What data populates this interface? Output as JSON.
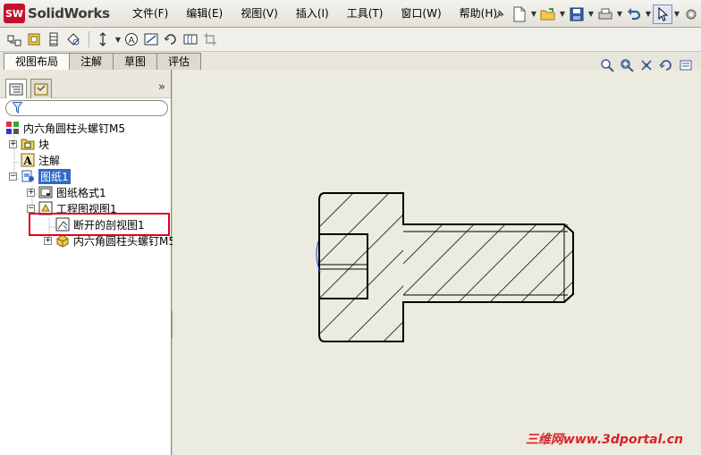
{
  "app": {
    "logo_text": "SolidWorks",
    "logo_badge": "SW"
  },
  "menu": {
    "items": [
      "文件(F)",
      "编辑(E)",
      "视图(V)",
      "插入(I)",
      "工具(T)",
      "窗口(W)",
      "帮助(H)"
    ]
  },
  "title_toolbar": {
    "icons": [
      "pushpin-icon",
      "new-document-icon",
      "open-folder-icon",
      "save-icon",
      "print-icon",
      "undo-icon",
      "select-arrow-icon",
      "options-icon"
    ]
  },
  "toolbar2": {
    "icons": [
      "model-view-icon",
      "projected-view-icon",
      "section-view-icon",
      "detail-view-icon",
      "alignment-icon",
      "text-annotation-icon",
      "block-icon",
      "rotate-icon",
      "broken-view-icon",
      "crop-icon"
    ]
  },
  "command_tabs": [
    {
      "label": "视图布局",
      "active": true
    },
    {
      "label": "注解",
      "active": false
    },
    {
      "label": "草图",
      "active": false
    },
    {
      "label": "评估",
      "active": false
    }
  ],
  "panel": {
    "tabs": [
      "feature-manager-icon",
      "property-manager-icon"
    ],
    "expand_glyph": "»",
    "filter_icon": "filter-icon"
  },
  "tree": {
    "root": "内六角圆柱头螺钉M5",
    "items": [
      {
        "label": "块",
        "icon": "block-folder-icon",
        "expander": "+"
      },
      {
        "label": "注解",
        "icon": "annotation-icon",
        "expander": ""
      },
      {
        "label": "图纸1",
        "icon": "sheet-icon",
        "expander": "−",
        "selected": true
      },
      {
        "label": "图纸格式1",
        "icon": "sheet-format-icon",
        "expander": "+"
      },
      {
        "label": "工程图视图1",
        "icon": "drawing-view-icon",
        "expander": "−"
      },
      {
        "label": "断开的剖视图1",
        "icon": "broken-section-view-icon",
        "expander": ""
      },
      {
        "label": "内六角圆柱头螺钉M5",
        "icon": "part-icon",
        "expander": "+"
      }
    ]
  },
  "view_tools": {
    "icons": [
      "zoom-to-fit-icon",
      "zoom-area-icon",
      "pan-icon",
      "rotate-view-icon",
      "more-icon"
    ]
  },
  "watermark": "三维网www.3dportal.cn",
  "colors": {
    "highlight_box": "#e3001b",
    "graphics_bg": "#ecebdf",
    "selection_bg": "#316ac5"
  }
}
